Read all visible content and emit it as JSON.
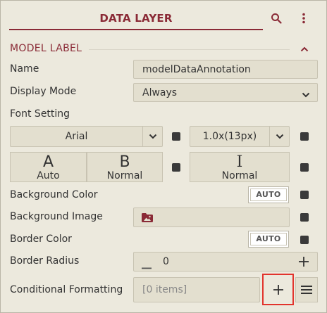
{
  "header": {
    "title": "DATA LAYER",
    "search_icon": "search-icon",
    "menu_icon": "more-vertical-icon"
  },
  "section": {
    "title": "MODEL LABEL",
    "toggle_icon": "chevron-up-icon"
  },
  "name": {
    "label": "Name",
    "value": "modelDataAnnotation"
  },
  "display_mode": {
    "label": "Display Mode",
    "value": "Always"
  },
  "font_setting": {
    "label": "Font Setting",
    "family": "Arial",
    "size": "1.0x(13px)"
  },
  "font_style": {
    "weight_glyph": "A",
    "weight_label": "Auto",
    "style_glyph": "B",
    "style_label": "Normal",
    "cursor_glyph": "I",
    "cursor_label": "Normal"
  },
  "background_color": {
    "label": "Background Color",
    "button": "AUTO"
  },
  "background_image": {
    "label": "Background Image",
    "icon": "image-folder-icon"
  },
  "border_color": {
    "label": "Border Color",
    "button": "AUTO"
  },
  "border_radius": {
    "label": "Border Radius",
    "value": "0"
  },
  "conditional_formatting": {
    "label": "Conditional Formatting",
    "value": "[0 items]"
  },
  "colors": {
    "accent": "#8a2a36",
    "highlight": "#e2342d",
    "panel": "#ece9dd"
  }
}
